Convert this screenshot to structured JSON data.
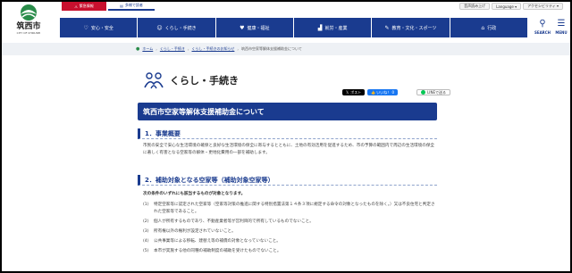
{
  "header": {
    "logo": {
      "text": "筑西市",
      "subtext": "CITY OF CHIKUSEI"
    },
    "top_buttons": {
      "emergency": "緊急情報",
      "language": "多様で読者"
    },
    "utility": [
      {
        "label": "音声読み上げ"
      },
      {
        "label": "Language ▾"
      },
      {
        "label": "アクセシビリティ ▾"
      }
    ],
    "nav": [
      {
        "label": "安心・安全",
        "icon": "shield-heart-icon"
      },
      {
        "label": "くらし・手続き",
        "icon": "family-icon"
      },
      {
        "label": "健康・福祉",
        "icon": "heart-icon"
      },
      {
        "label": "就労・産業",
        "icon": "factory-icon"
      },
      {
        "label": "教育・文化・スポーツ",
        "icon": "book-icon"
      },
      {
        "label": "行政",
        "icon": "building-icon"
      }
    ],
    "search_label": "SEARCH",
    "menu_label": "MENU"
  },
  "breadcrumb": [
    "ホーム",
    "くらし・手続き",
    "くらし・手続きのお知らせ",
    "筑西市空家等解体支援補助金について"
  ],
  "category": {
    "title": "くらし・手続き",
    "icon": "family-icon"
  },
  "share": {
    "x": "ポスト",
    "facebook": "いいね！ 0",
    "line": "LINEで送る"
  },
  "page_title": "筑西市空家等解体支援補助金について",
  "section1": {
    "heading": "1．事業概要",
    "body": "市民の安全で安心な生活環境の確保と良好な生活環境の保全に寄与するとともに、土地の有効活用を促進するため、市の予算の範囲内で周辺の生活環境の保全に著しく有害となる空家等の解体・更地化費用の一部を補助します。"
  },
  "section2": {
    "heading": "2．補助対象となる空家等（補助対象空家等）",
    "intro": "次の条件のいずれにも該当するものが対象となります。",
    "conditions": [
      {
        "no": "(1)",
        "text": "特定空家等に認定された空家等（空家等対策の推進に関する特別措置法第１４条３項に規定する命令の対象となったものを除く。）又は不良住宅と判定された空家等であること。"
      },
      {
        "no": "(2)",
        "text": "個人が所有するものであり、不動産業者等が営利目的で所有しているものでないこと。"
      },
      {
        "no": "(3)",
        "text": "所有権以外の権利が設定されていないこと。"
      },
      {
        "no": "(4)",
        "text": "公共事業等による移転、建替え等の補償の対象となっていないこと。"
      },
      {
        "no": "(5)",
        "text": "本市が実施する他の同種の補助制度の補助を受けたものでないこと。"
      }
    ]
  },
  "colors": {
    "brand_blue": "#1a3b8f",
    "emergency_red": "#c8102e",
    "crumb_bg": "#eef1f5"
  }
}
